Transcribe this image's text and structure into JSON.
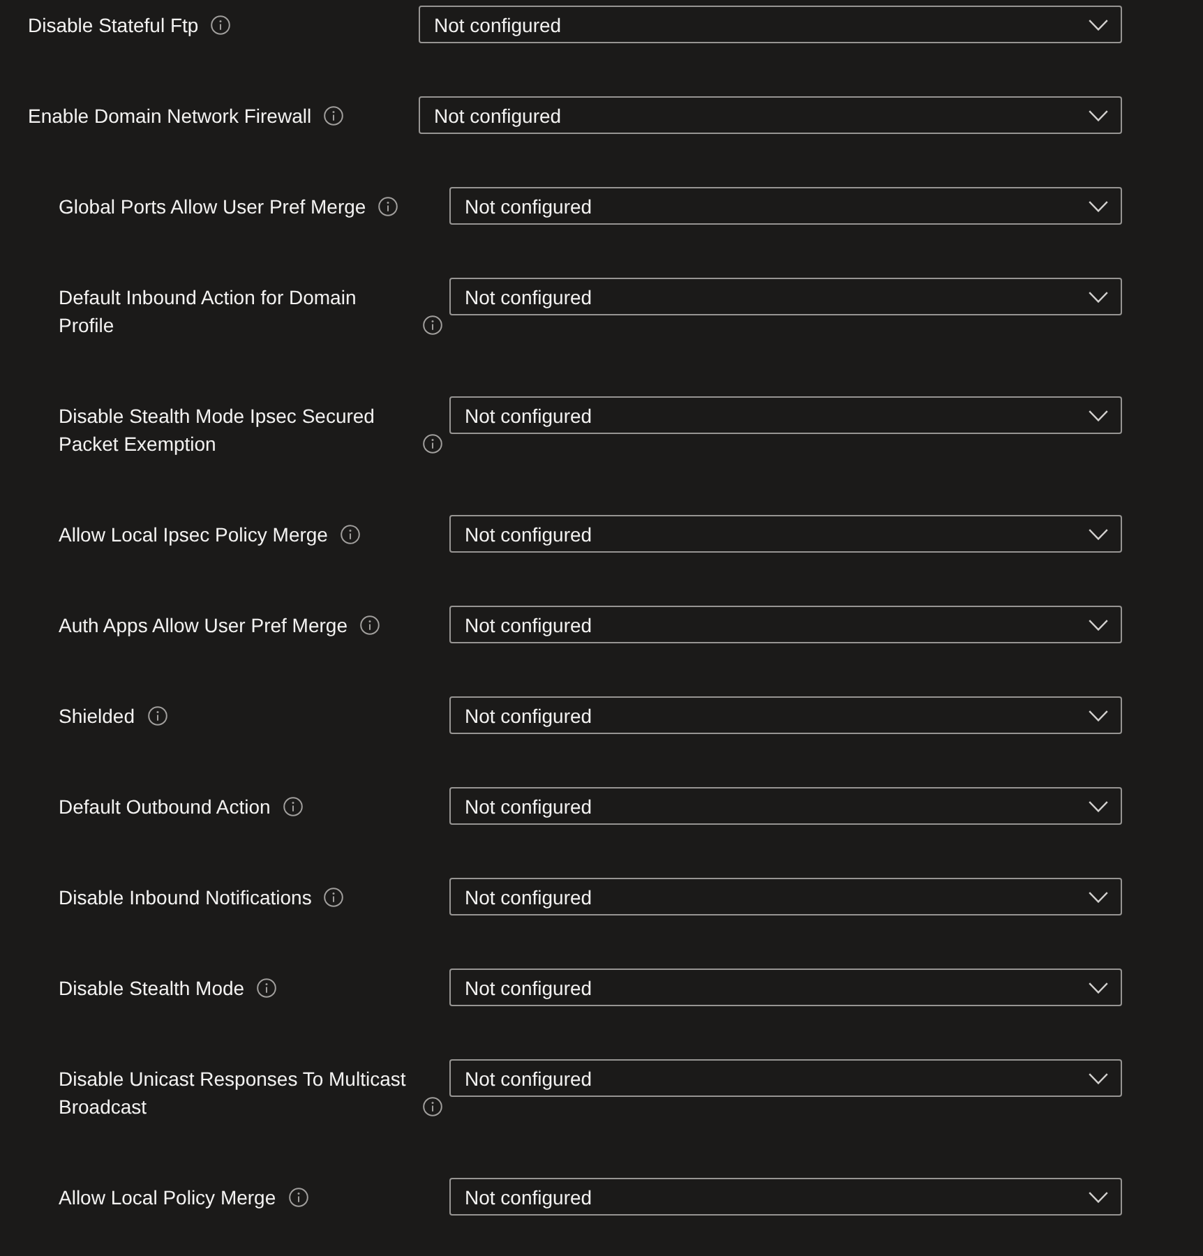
{
  "settings": [
    {
      "label": "Disable Stateful Ftp",
      "value": "Not configured"
    },
    {
      "label": "Enable Domain Network Firewall",
      "value": "Not configured",
      "children": [
        {
          "label": "Global Ports Allow User Pref Merge",
          "value": "Not configured"
        },
        {
          "label": "Default Inbound Action for Domain Profile",
          "value": "Not configured"
        },
        {
          "label": "Disable Stealth Mode Ipsec Secured Packet Exemption",
          "value": "Not configured"
        },
        {
          "label": "Allow Local Ipsec Policy Merge",
          "value": "Not configured"
        },
        {
          "label": "Auth Apps Allow User Pref Merge",
          "value": "Not configured"
        },
        {
          "label": "Shielded",
          "value": "Not configured"
        },
        {
          "label": "Default Outbound Action",
          "value": "Not configured"
        },
        {
          "label": "Disable Inbound Notifications",
          "value": "Not configured"
        },
        {
          "label": "Disable Stealth Mode",
          "value": "Not configured"
        },
        {
          "label": "Disable Unicast Responses To Multicast Broadcast",
          "value": "Not configured"
        },
        {
          "label": "Allow Local Policy Merge",
          "value": "Not configured"
        }
      ]
    }
  ]
}
